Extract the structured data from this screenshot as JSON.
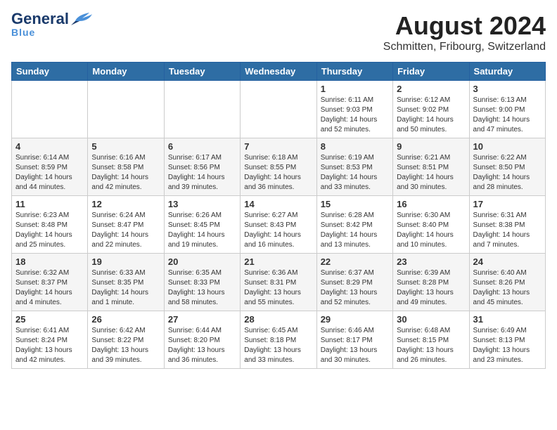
{
  "header": {
    "logo_general": "General",
    "logo_blue": "Blue",
    "month_title": "August 2024",
    "location": "Schmitten, Fribourg, Switzerland"
  },
  "weekdays": [
    "Sunday",
    "Monday",
    "Tuesday",
    "Wednesday",
    "Thursday",
    "Friday",
    "Saturday"
  ],
  "weeks": [
    [
      {
        "day": "",
        "info": ""
      },
      {
        "day": "",
        "info": ""
      },
      {
        "day": "",
        "info": ""
      },
      {
        "day": "",
        "info": ""
      },
      {
        "day": "1",
        "info": "Sunrise: 6:11 AM\nSunset: 9:03 PM\nDaylight: 14 hours\nand 52 minutes."
      },
      {
        "day": "2",
        "info": "Sunrise: 6:12 AM\nSunset: 9:02 PM\nDaylight: 14 hours\nand 50 minutes."
      },
      {
        "day": "3",
        "info": "Sunrise: 6:13 AM\nSunset: 9:00 PM\nDaylight: 14 hours\nand 47 minutes."
      }
    ],
    [
      {
        "day": "4",
        "info": "Sunrise: 6:14 AM\nSunset: 8:59 PM\nDaylight: 14 hours\nand 44 minutes."
      },
      {
        "day": "5",
        "info": "Sunrise: 6:16 AM\nSunset: 8:58 PM\nDaylight: 14 hours\nand 42 minutes."
      },
      {
        "day": "6",
        "info": "Sunrise: 6:17 AM\nSunset: 8:56 PM\nDaylight: 14 hours\nand 39 minutes."
      },
      {
        "day": "7",
        "info": "Sunrise: 6:18 AM\nSunset: 8:55 PM\nDaylight: 14 hours\nand 36 minutes."
      },
      {
        "day": "8",
        "info": "Sunrise: 6:19 AM\nSunset: 8:53 PM\nDaylight: 14 hours\nand 33 minutes."
      },
      {
        "day": "9",
        "info": "Sunrise: 6:21 AM\nSunset: 8:51 PM\nDaylight: 14 hours\nand 30 minutes."
      },
      {
        "day": "10",
        "info": "Sunrise: 6:22 AM\nSunset: 8:50 PM\nDaylight: 14 hours\nand 28 minutes."
      }
    ],
    [
      {
        "day": "11",
        "info": "Sunrise: 6:23 AM\nSunset: 8:48 PM\nDaylight: 14 hours\nand 25 minutes."
      },
      {
        "day": "12",
        "info": "Sunrise: 6:24 AM\nSunset: 8:47 PM\nDaylight: 14 hours\nand 22 minutes."
      },
      {
        "day": "13",
        "info": "Sunrise: 6:26 AM\nSunset: 8:45 PM\nDaylight: 14 hours\nand 19 minutes."
      },
      {
        "day": "14",
        "info": "Sunrise: 6:27 AM\nSunset: 8:43 PM\nDaylight: 14 hours\nand 16 minutes."
      },
      {
        "day": "15",
        "info": "Sunrise: 6:28 AM\nSunset: 8:42 PM\nDaylight: 14 hours\nand 13 minutes."
      },
      {
        "day": "16",
        "info": "Sunrise: 6:30 AM\nSunset: 8:40 PM\nDaylight: 14 hours\nand 10 minutes."
      },
      {
        "day": "17",
        "info": "Sunrise: 6:31 AM\nSunset: 8:38 PM\nDaylight: 14 hours\nand 7 minutes."
      }
    ],
    [
      {
        "day": "18",
        "info": "Sunrise: 6:32 AM\nSunset: 8:37 PM\nDaylight: 14 hours\nand 4 minutes."
      },
      {
        "day": "19",
        "info": "Sunrise: 6:33 AM\nSunset: 8:35 PM\nDaylight: 14 hours\nand 1 minute."
      },
      {
        "day": "20",
        "info": "Sunrise: 6:35 AM\nSunset: 8:33 PM\nDaylight: 13 hours\nand 58 minutes."
      },
      {
        "day": "21",
        "info": "Sunrise: 6:36 AM\nSunset: 8:31 PM\nDaylight: 13 hours\nand 55 minutes."
      },
      {
        "day": "22",
        "info": "Sunrise: 6:37 AM\nSunset: 8:29 PM\nDaylight: 13 hours\nand 52 minutes."
      },
      {
        "day": "23",
        "info": "Sunrise: 6:39 AM\nSunset: 8:28 PM\nDaylight: 13 hours\nand 49 minutes."
      },
      {
        "day": "24",
        "info": "Sunrise: 6:40 AM\nSunset: 8:26 PM\nDaylight: 13 hours\nand 45 minutes."
      }
    ],
    [
      {
        "day": "25",
        "info": "Sunrise: 6:41 AM\nSunset: 8:24 PM\nDaylight: 13 hours\nand 42 minutes."
      },
      {
        "day": "26",
        "info": "Sunrise: 6:42 AM\nSunset: 8:22 PM\nDaylight: 13 hours\nand 39 minutes."
      },
      {
        "day": "27",
        "info": "Sunrise: 6:44 AM\nSunset: 8:20 PM\nDaylight: 13 hours\nand 36 minutes."
      },
      {
        "day": "28",
        "info": "Sunrise: 6:45 AM\nSunset: 8:18 PM\nDaylight: 13 hours\nand 33 minutes."
      },
      {
        "day": "29",
        "info": "Sunrise: 6:46 AM\nSunset: 8:17 PM\nDaylight: 13 hours\nand 30 minutes."
      },
      {
        "day": "30",
        "info": "Sunrise: 6:48 AM\nSunset: 8:15 PM\nDaylight: 13 hours\nand 26 minutes."
      },
      {
        "day": "31",
        "info": "Sunrise: 6:49 AM\nSunset: 8:13 PM\nDaylight: 13 hours\nand 23 minutes."
      }
    ]
  ]
}
